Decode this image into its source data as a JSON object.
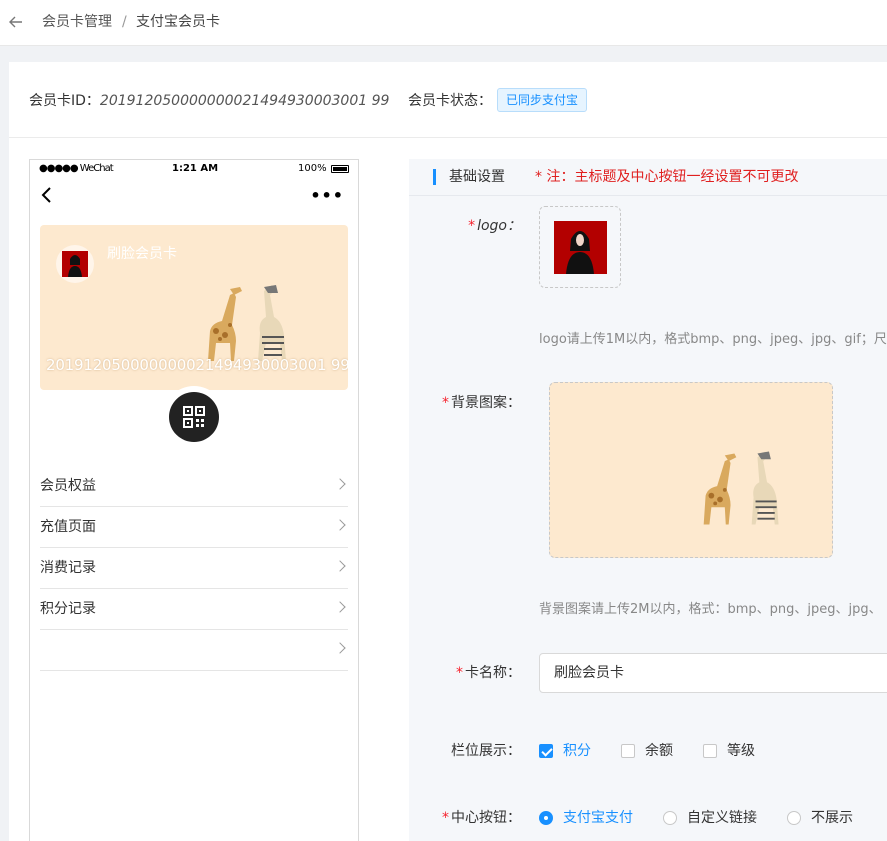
{
  "breadcrumb": {
    "parent": "会员卡管理",
    "separator": "/",
    "current": "支付宝会员卡"
  },
  "info": {
    "card_id_label": "会员卡ID：",
    "card_id_value": "201912050000000021494930003001 99",
    "status_label": "会员卡状态：",
    "status_badge": "已同步支付宝"
  },
  "phone": {
    "carrier": "●●●●● WeChat",
    "time": "1:21 AM",
    "battery_text": "100%",
    "card_title": "刷脸会员卡",
    "card_number": "201912050000000021494930003001 99",
    "menu": [
      {
        "label": "会员权益"
      },
      {
        "label": "充值页面"
      },
      {
        "label": "消费记录"
      },
      {
        "label": "积分记录"
      },
      {
        "label": ""
      }
    ]
  },
  "form": {
    "section_title": "基础设置",
    "section_note": "*  注：主标题及中心按钮一经设置不可更改",
    "logo_label": "logo：",
    "logo_hint": "logo请上传1M以内，格式bmp、png、jpeg、jpg、gif；尺",
    "bg_label": "背景图案：",
    "bg_hint": "背景图案请上传2M以内，格式：bmp、png、jpeg、jpg、",
    "name_label": "卡名称：",
    "name_value": "刷脸会员卡",
    "columns_label": "栏位展示：",
    "columns": [
      {
        "label": "积分",
        "checked": true
      },
      {
        "label": "余额",
        "checked": false
      },
      {
        "label": "等级",
        "checked": false
      }
    ],
    "center_btn_label": "中心按钮：",
    "center_btn_options": [
      {
        "label": "支付宝支付",
        "checked": true
      },
      {
        "label": "自定义链接",
        "checked": false
      },
      {
        "label": "不展示",
        "checked": false
      }
    ]
  },
  "colors": {
    "accent": "#1890ff",
    "warning": "#e02020",
    "card_bg": "#fde9cf"
  }
}
